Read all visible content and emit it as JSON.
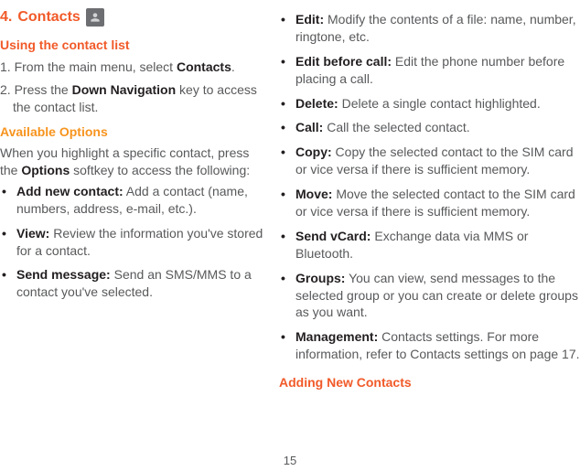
{
  "page_number": "15",
  "left": {
    "section_number": "4.",
    "section_title": "Contacts",
    "icon": "contacts-icon",
    "h_using": "Using the contact list",
    "step1_pre": "1. From the main menu, select ",
    "step1_bold": "Contacts",
    "step1_post": ".",
    "step2_pre": "2. Press the ",
    "step2_bold": "Down Navigation",
    "step2_post": " key to access the contact list.",
    "h_available": "Available Options",
    "intro_pre": "When you highlight a specific contact, press the ",
    "intro_bold": "Options",
    "intro_post": " softkey to access the following:",
    "bullets": [
      {
        "bold": "Add new contact:",
        "text": " Add a contact (name, numbers, address, e-mail, etc.)."
      },
      {
        "bold": "View:",
        "text": " Review the information you've stored for a contact."
      },
      {
        "bold": "Send message:",
        "text": " Send an SMS/MMS to a contact you've selected."
      }
    ]
  },
  "right": {
    "bullets": [
      {
        "bold": "Edit:",
        "text": " Modify the contents of a file: name, number, ringtone, etc."
      },
      {
        "bold": "Edit before call:",
        "text": " Edit the phone number before placing a call."
      },
      {
        "bold": "Delete:",
        "text": " Delete a single contact highlighted."
      },
      {
        "bold": "Call:",
        "text": " Call the selected contact."
      },
      {
        "bold": "Copy:",
        "text": " Copy the selected contact to the SIM card or vice versa if there is sufficient memory."
      },
      {
        "bold": "Move:",
        "text": " Move the selected contact to the SIM card or vice versa if there is sufficient memory."
      },
      {
        "bold": "Send vCard:",
        "text": " Exchange data via MMS or Bluetooth."
      },
      {
        "bold": "Groups:",
        "text": " You can view, send messages to the selected group or you can create or delete groups as you want."
      },
      {
        "bold": "Management:",
        "text": " Contacts settings. For more information, refer to Contacts settings on page 17."
      }
    ],
    "h_adding": "Adding New Contacts"
  }
}
